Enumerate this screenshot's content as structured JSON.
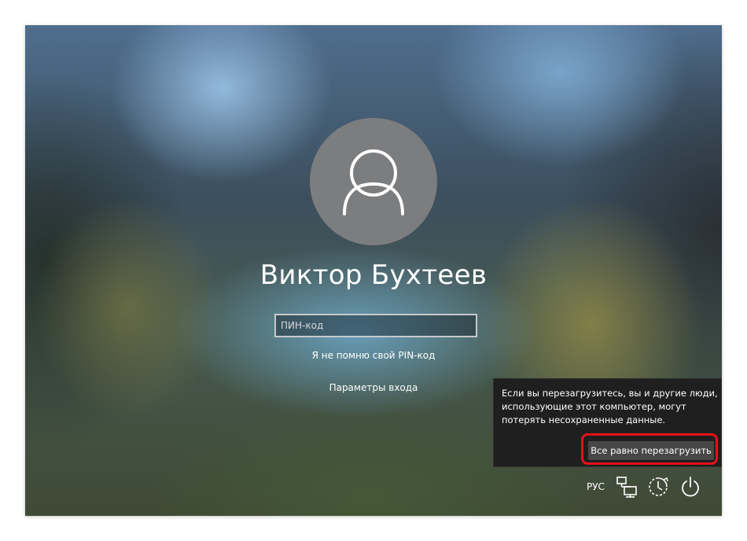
{
  "user": {
    "name": "Виктор Бухтеев",
    "avatar_icon": "user-silhouette-icon"
  },
  "login": {
    "pin_placeholder": "ПИН-код",
    "pin_value": "",
    "forgot_pin_link": "Я не помню свой PIN-код",
    "signin_options_link": "Параметры входа"
  },
  "restart_flyout": {
    "message": "Если вы перезагрузитесь, вы и другие люди, использующие этот компьютер, могут потерять несохраненные данные.",
    "button_label": "Все равно перезагрузить",
    "highlight_color": "#e8101a"
  },
  "tray": {
    "language": "РУС",
    "icons": [
      "network-icon",
      "accessibility-icon",
      "power-icon"
    ]
  }
}
